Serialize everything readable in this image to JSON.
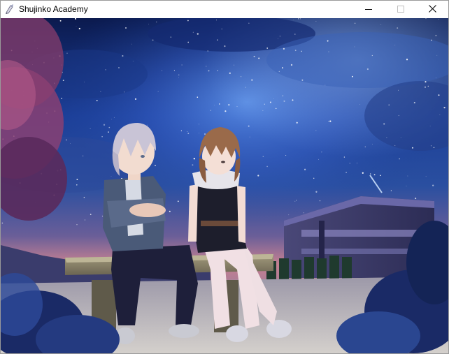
{
  "window": {
    "title": "Shujinko Academy",
    "icon": "app-sketch-icon",
    "controls": [
      "minimize-icon",
      "maximize-icon",
      "close-icon"
    ]
  },
  "scene": {
    "setting": "night-sky-bench",
    "colors": {
      "sky_top": "#0a1640",
      "sky_mid": "#1f4aa8",
      "horizon": "#c07a8a",
      "ground": "#b9b6b8",
      "bench": "#8a8268",
      "foliage": "#1a2a6a"
    }
  }
}
